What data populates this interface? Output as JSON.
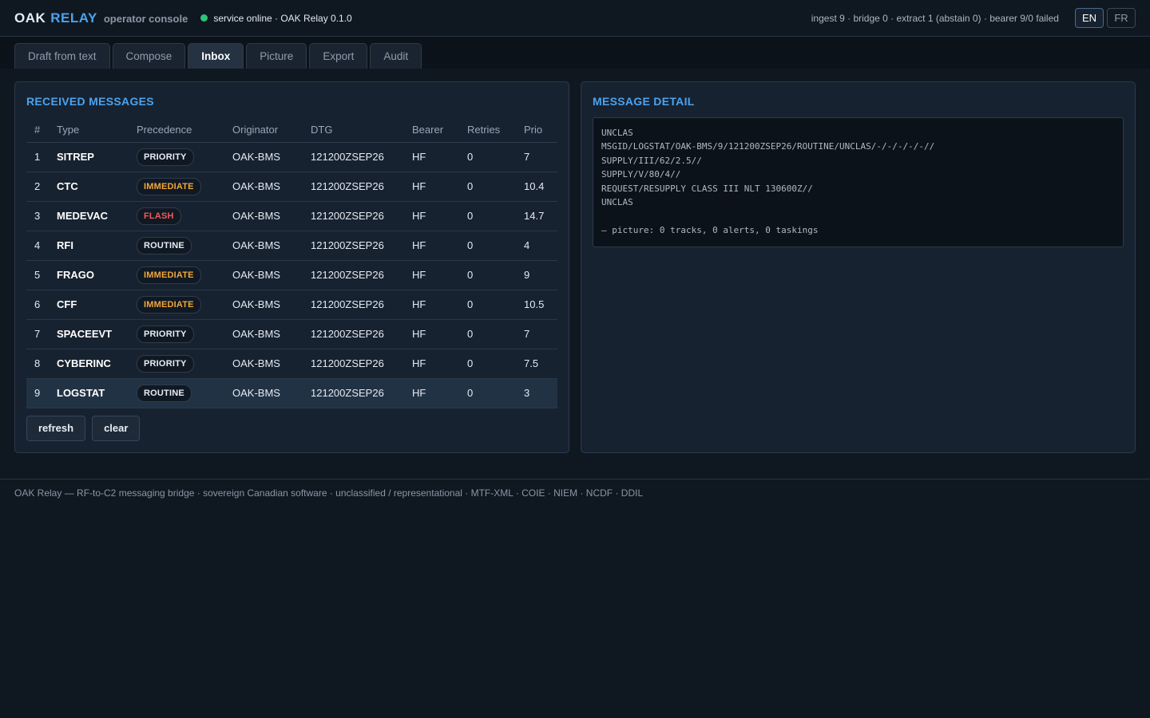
{
  "header": {
    "brand_oak": "OAK",
    "brand_relay": "RELAY",
    "brand_sub": "operator console",
    "service_status": "service online · OAK Relay 0.1.0",
    "stats": "ingest 9 · bridge 0 · extract 1 (abstain 0) · bearer 9/0 failed",
    "lang_en": "EN",
    "lang_fr": "FR",
    "status_color": "#2ec47a",
    "accent_color": "#4aa3f0"
  },
  "tabs": [
    {
      "label": "Draft from text"
    },
    {
      "label": "Compose"
    },
    {
      "label": "Inbox",
      "active": true
    },
    {
      "label": "Picture"
    },
    {
      "label": "Export"
    },
    {
      "label": "Audit"
    }
  ],
  "inbox": {
    "title": "RECEIVED MESSAGES",
    "columns": [
      "#",
      "Type",
      "Precedence",
      "Originator",
      "DTG",
      "Bearer",
      "Retries",
      "Prio"
    ],
    "rows": [
      {
        "n": "1",
        "type": "SITREP",
        "precedence": "PRIORITY",
        "originator": "OAK-BMS",
        "dtg": "121200ZSEP26",
        "bearer": "HF",
        "retries": "0",
        "prio": "7"
      },
      {
        "n": "2",
        "type": "CTC",
        "precedence": "IMMEDIATE",
        "originator": "OAK-BMS",
        "dtg": "121200ZSEP26",
        "bearer": "HF",
        "retries": "0",
        "prio": "10.4"
      },
      {
        "n": "3",
        "type": "MEDEVAC",
        "precedence": "FLASH",
        "originator": "OAK-BMS",
        "dtg": "121200ZSEP26",
        "bearer": "HF",
        "retries": "0",
        "prio": "14.7"
      },
      {
        "n": "4",
        "type": "RFI",
        "precedence": "ROUTINE",
        "originator": "OAK-BMS",
        "dtg": "121200ZSEP26",
        "bearer": "HF",
        "retries": "0",
        "prio": "4"
      },
      {
        "n": "5",
        "type": "FRAGO",
        "precedence": "IMMEDIATE",
        "originator": "OAK-BMS",
        "dtg": "121200ZSEP26",
        "bearer": "HF",
        "retries": "0",
        "prio": "9"
      },
      {
        "n": "6",
        "type": "CFF",
        "precedence": "IMMEDIATE",
        "originator": "OAK-BMS",
        "dtg": "121200ZSEP26",
        "bearer": "HF",
        "retries": "0",
        "prio": "10.5"
      },
      {
        "n": "7",
        "type": "SPACEEVT",
        "precedence": "PRIORITY",
        "originator": "OAK-BMS",
        "dtg": "121200ZSEP26",
        "bearer": "HF",
        "retries": "0",
        "prio": "7"
      },
      {
        "n": "8",
        "type": "CYBERINC",
        "precedence": "PRIORITY",
        "originator": "OAK-BMS",
        "dtg": "121200ZSEP26",
        "bearer": "HF",
        "retries": "0",
        "prio": "7.5"
      },
      {
        "n": "9",
        "type": "LOGSTAT",
        "precedence": "ROUTINE",
        "originator": "OAK-BMS",
        "dtg": "121200ZSEP26",
        "bearer": "HF",
        "retries": "0",
        "prio": "3",
        "selected": true
      }
    ],
    "refresh_label": "refresh",
    "clear_label": "clear"
  },
  "detail": {
    "title": "MESSAGE DETAIL",
    "text": "UNCLAS\nMSGID/LOGSTAT/OAK-BMS/9/121200ZSEP26/ROUTINE/UNCLAS/-/-/-/-/-//\nSUPPLY/III/62/2.5//\nSUPPLY/V/80/4//\nREQUEST/RESUPPLY CLASS III NLT 130600Z//\nUNCLAS\n\n— picture: 0 tracks, 0 alerts, 0 taskings"
  },
  "footer": {
    "text": "OAK Relay — RF-to-C2 messaging bridge · sovereign Canadian software · unclassified / representational · MTF-XML · COIE · NIEM · NCDF · DDIL"
  },
  "precedence_colors": {
    "FLASH": "#f15a5a",
    "IMMEDIATE": "#f2a63a",
    "PRIORITY": "#e6edf5",
    "ROUTINE": "#e6edf5"
  }
}
